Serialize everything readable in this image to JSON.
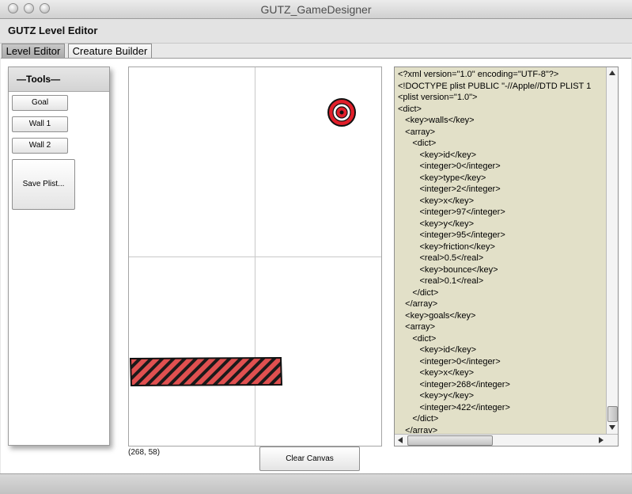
{
  "window": {
    "title": "GUTZ_GameDesigner"
  },
  "app": {
    "header": "GUTZ Level Editor"
  },
  "tabs": [
    {
      "label": "Level Editor",
      "active": true
    },
    {
      "label": "Creature Builder",
      "active": false
    }
  ],
  "tools": {
    "heading": "—Tools—",
    "buttons": {
      "goal": "Goal",
      "wall1": "Wall 1",
      "wall2": "Wall 2",
      "save": "Save Plist..."
    }
  },
  "canvas": {
    "coords": "(268, 58)",
    "objects": [
      {
        "kind": "goal",
        "icon": "target-icon"
      },
      {
        "kind": "wall",
        "pattern": "red-black-stripes"
      }
    ]
  },
  "clear_button": "Clear Canvas",
  "xml_lines": [
    "<?xml version=\"1.0\" encoding=\"UTF-8\"?>",
    "<!DOCTYPE plist PUBLIC \"-//Apple//DTD PLIST 1",
    "<plist version=\"1.0\">",
    "<dict>",
    "   <key>walls</key>",
    "   <array>",
    "      <dict>",
    "         <key>id</key>",
    "         <integer>0</integer>",
    "         <key>type</key>",
    "         <integer>2</integer>",
    "         <key>x</key>",
    "         <integer>97</integer>",
    "         <key>y</key>",
    "         <integer>95</integer>",
    "         <key>friction</key>",
    "         <real>0.5</real>",
    "         <key>bounce</key>",
    "         <real>0.1</real>",
    "      </dict>",
    "   </array>",
    "   <key>goals</key>",
    "   <array>",
    "      <dict>",
    "         <key>id</key>",
    "         <integer>0</integer>",
    "         <key>x</key>",
    "         <integer>268</integer>",
    "         <key>y</key>",
    "         <integer>422</integer>",
    "      </dict>",
    "   </array>"
  ],
  "colors": {
    "goal_red": "#e21f2a",
    "wall_red": "#e05050",
    "xml_bg": "#e2e0c8"
  }
}
